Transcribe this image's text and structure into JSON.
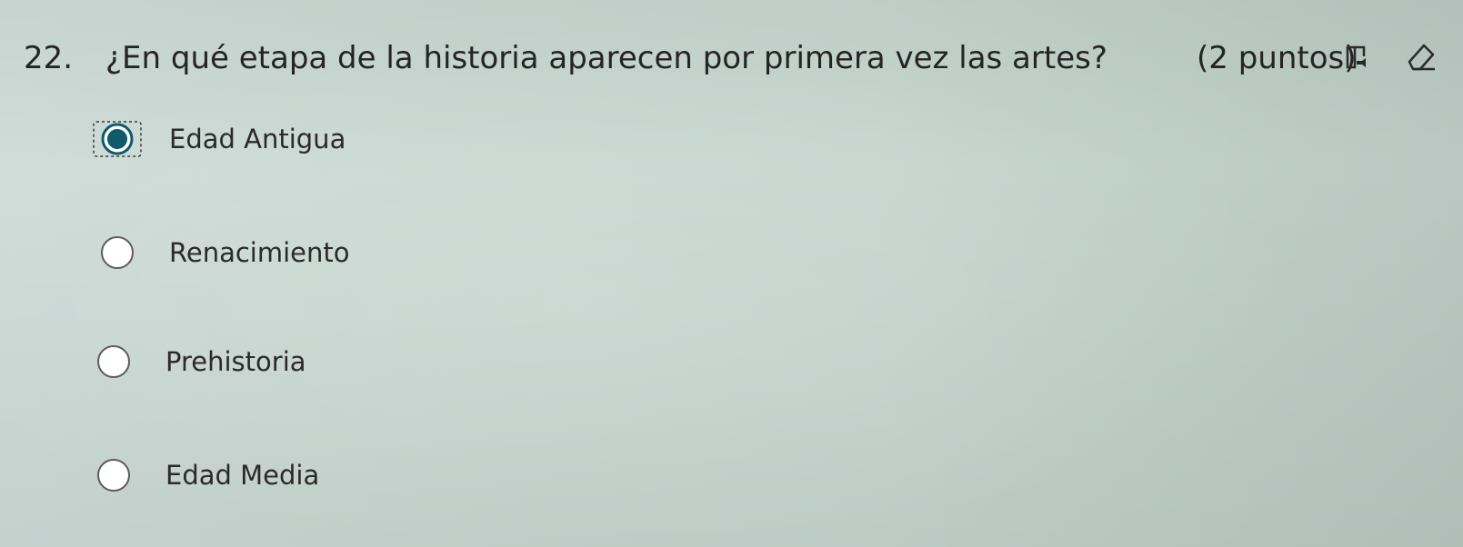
{
  "question": {
    "number": "22.",
    "text": "¿En qué etapa de la historia aparecen por primera vez las artes?",
    "points": "(2 puntos)"
  },
  "toolbar": {
    "reader_icon": "immersive-reader-icon",
    "eraser_icon": "eraser-icon"
  },
  "options": [
    {
      "label": "Edad Antigua",
      "selected": true
    },
    {
      "label": "Renacimiento",
      "selected": false
    },
    {
      "label": "Prehistoria",
      "selected": false
    },
    {
      "label": "Edad Media",
      "selected": false
    }
  ],
  "colors": {
    "accent": "#0f5a6b",
    "text": "#262626",
    "radio_border": "#5c5c5c"
  }
}
